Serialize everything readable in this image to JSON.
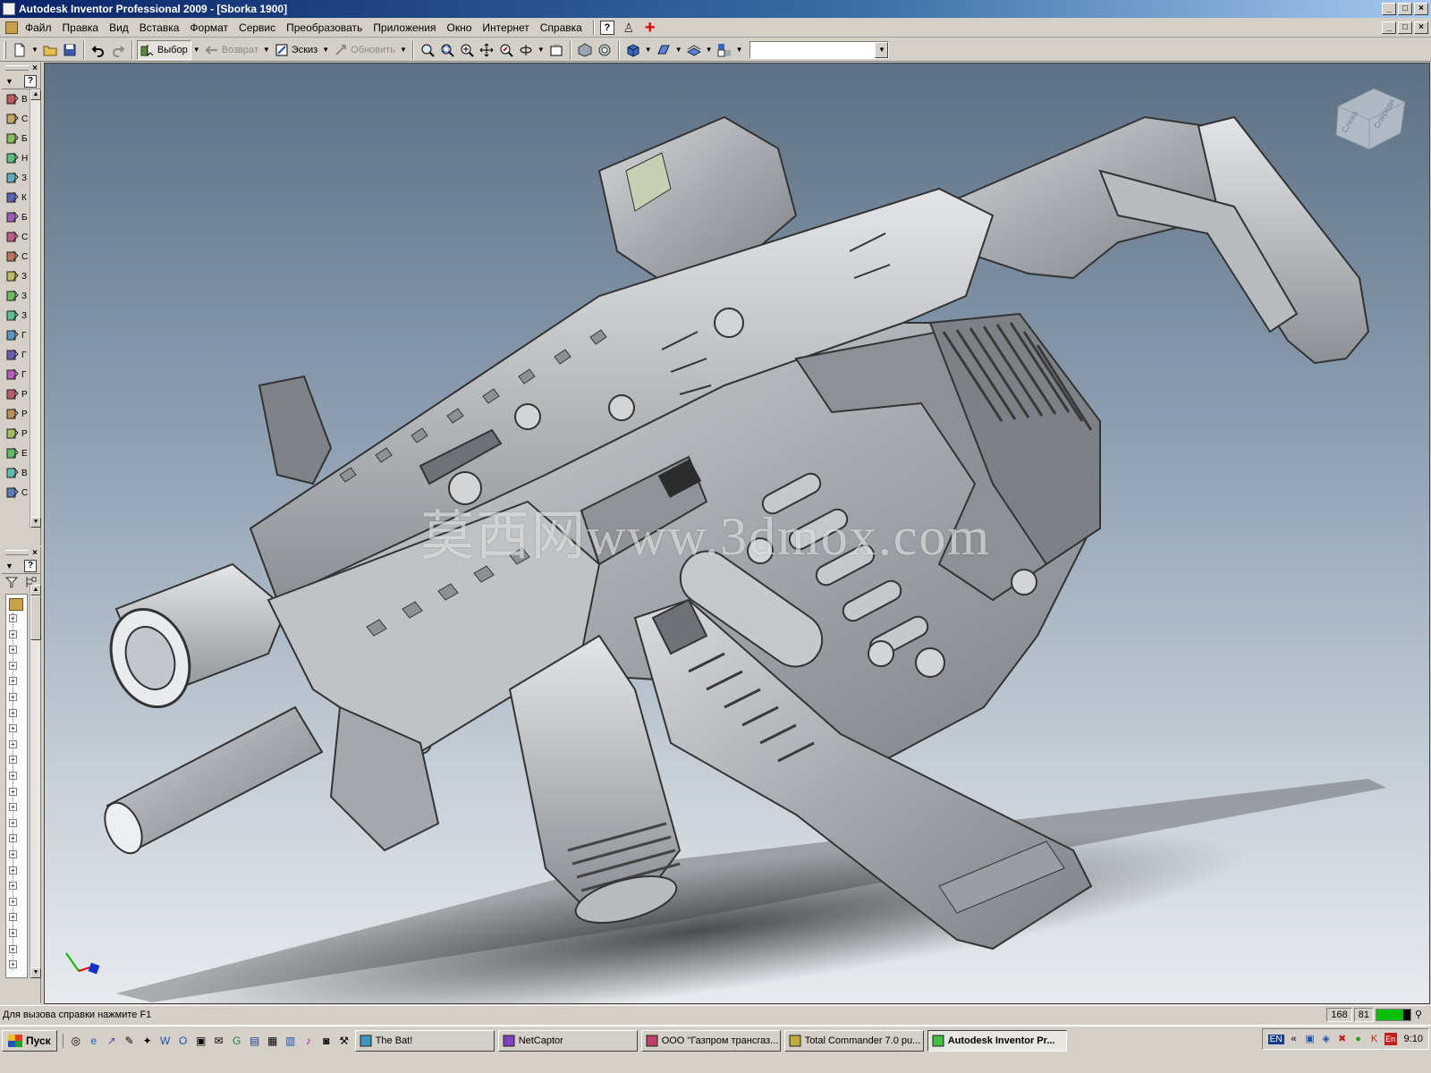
{
  "window": {
    "title": "Autodesk Inventor Professional 2009 - [Sborka 1900]",
    "minimize": "_",
    "maximize": "□",
    "close": "×"
  },
  "menu": {
    "items": [
      "Файл",
      "Правка",
      "Вид",
      "Вставка",
      "Формат",
      "Сервис",
      "Преобразовать",
      "Приложения",
      "Окно",
      "Интернет",
      "Справка"
    ],
    "help": "?"
  },
  "toolbar": {
    "select_label": "Выбор",
    "return_label": "Возврат",
    "sketch_label": "Эскиз",
    "update_label": "Обновить",
    "combo_value": ""
  },
  "panel": {
    "close": "×",
    "help": "?",
    "tools": [
      {
        "icon": "place-component-icon",
        "label": "В"
      },
      {
        "icon": "create-component-icon",
        "label": "С"
      },
      {
        "icon": "pattern-component-icon",
        "label": "Б"
      },
      {
        "icon": "mirror-components-icon",
        "label": "Н"
      },
      {
        "icon": "copy-components-icon",
        "label": "З"
      },
      {
        "icon": "replace-component-icon",
        "label": "К"
      },
      {
        "icon": "constraint-icon",
        "label": "Б"
      },
      {
        "icon": "motion-icon",
        "label": "С"
      },
      {
        "icon": "transitional-icon",
        "label": "С"
      },
      {
        "icon": "move-component-icon",
        "label": "З"
      },
      {
        "icon": "rotate-component-icon",
        "label": "З"
      },
      {
        "icon": "section-icon",
        "label": "З"
      },
      {
        "icon": "analyze-icon",
        "label": "Г"
      },
      {
        "icon": "work-plane-icon",
        "label": "Г"
      },
      {
        "icon": "work-axis-icon",
        "label": "Г"
      },
      {
        "icon": "work-point-icon",
        "label": "Р"
      },
      {
        "icon": "ucs-icon",
        "label": "Р"
      },
      {
        "icon": "bom-icon",
        "label": "Р"
      },
      {
        "icon": "parameters-icon",
        "label": "Е"
      },
      {
        "icon": "create-view-icon",
        "label": "В"
      },
      {
        "icon": "shrinkwrap-icon",
        "label": "С"
      }
    ]
  },
  "status": {
    "help_text": "Для вызова справки нажмите F1",
    "count_a": "168",
    "count_b": "81",
    "memory_fill": 0.8
  },
  "viewport": {
    "watermark": "莫西网www.3dmox.com",
    "viewcube_left": "Слева",
    "viewcube_front": "Спереди"
  },
  "taskbar": {
    "start_label": "Пуск",
    "tasks": [
      {
        "label": "The Bat!",
        "active": false
      },
      {
        "label": "NetCaptor",
        "active": false
      },
      {
        "label": "ООО \"Газпром трансгаз...",
        "active": false
      },
      {
        "label": "Total Commander 7.0 pu...",
        "active": false
      },
      {
        "label": "Autodesk Inventor Pr...",
        "active": true
      }
    ],
    "tray_lang": "EN",
    "tray_lang2": "En",
    "clock": "9:10"
  }
}
